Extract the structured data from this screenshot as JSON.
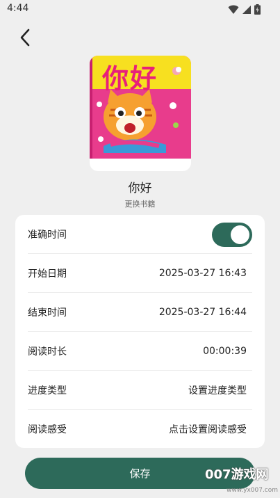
{
  "status_bar": {
    "time": "4:44",
    "icons": [
      "wifi-icon",
      "signal-icon",
      "battery-icon"
    ]
  },
  "book": {
    "cover_title": "你好",
    "title": "你好",
    "change_label": "更换书籍"
  },
  "form": {
    "rows": [
      {
        "label": "准确时间",
        "type": "toggle",
        "toggle_on": true
      },
      {
        "label": "开始日期",
        "value": "2025-03-27 16:43"
      },
      {
        "label": "结束时间",
        "value": "2025-03-27 16:44"
      },
      {
        "label": "阅读时长",
        "value": "00:00:39"
      },
      {
        "label": "进度类型",
        "value": "设置进度类型"
      },
      {
        "label": "阅读感受",
        "value": "点击设置阅读感受"
      }
    ]
  },
  "save_label": "保存",
  "watermark": {
    "main": "007游戏网",
    "sub": "www.yx007.com"
  },
  "colors": {
    "accent": "#2d6a5a",
    "background": "#efefef",
    "panel": "#ffffff",
    "cover_yellow": "#f7e020",
    "cover_pink": "#e83c8c"
  }
}
